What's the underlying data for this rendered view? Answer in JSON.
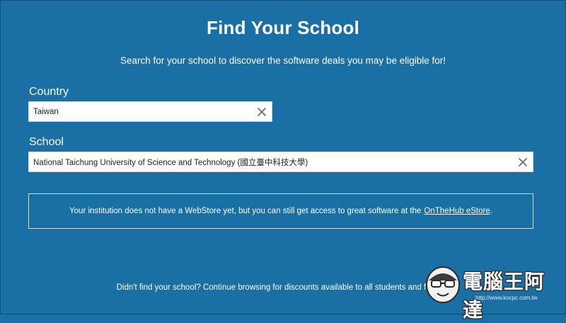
{
  "page": {
    "title": "Find Your School",
    "subtitle": "Search for your school to discover the software deals you may be eligible for!"
  },
  "country": {
    "label": "Country",
    "value": "Taiwan",
    "clear_icon": "close-icon"
  },
  "school": {
    "label": "School",
    "value": "National Taichung University of Science and Technology (國立臺中科技大學)",
    "clear_icon": "close-icon"
  },
  "notice": {
    "text": "Your institution does not have a WebStore yet, but you can still get access to great software at the",
    "link_label": "OnTheHub eStore",
    "trailing": "."
  },
  "footer": {
    "text": "Didn't find your school? Continue browsing for discounts available to all students and faculty!"
  },
  "watermark": {
    "text": "電腦王阿達",
    "url": "http://www.kocpc.com.tw"
  },
  "colors": {
    "background": "#1a6fa5",
    "text": "#ffffff",
    "input_bg": "#ffffff"
  }
}
